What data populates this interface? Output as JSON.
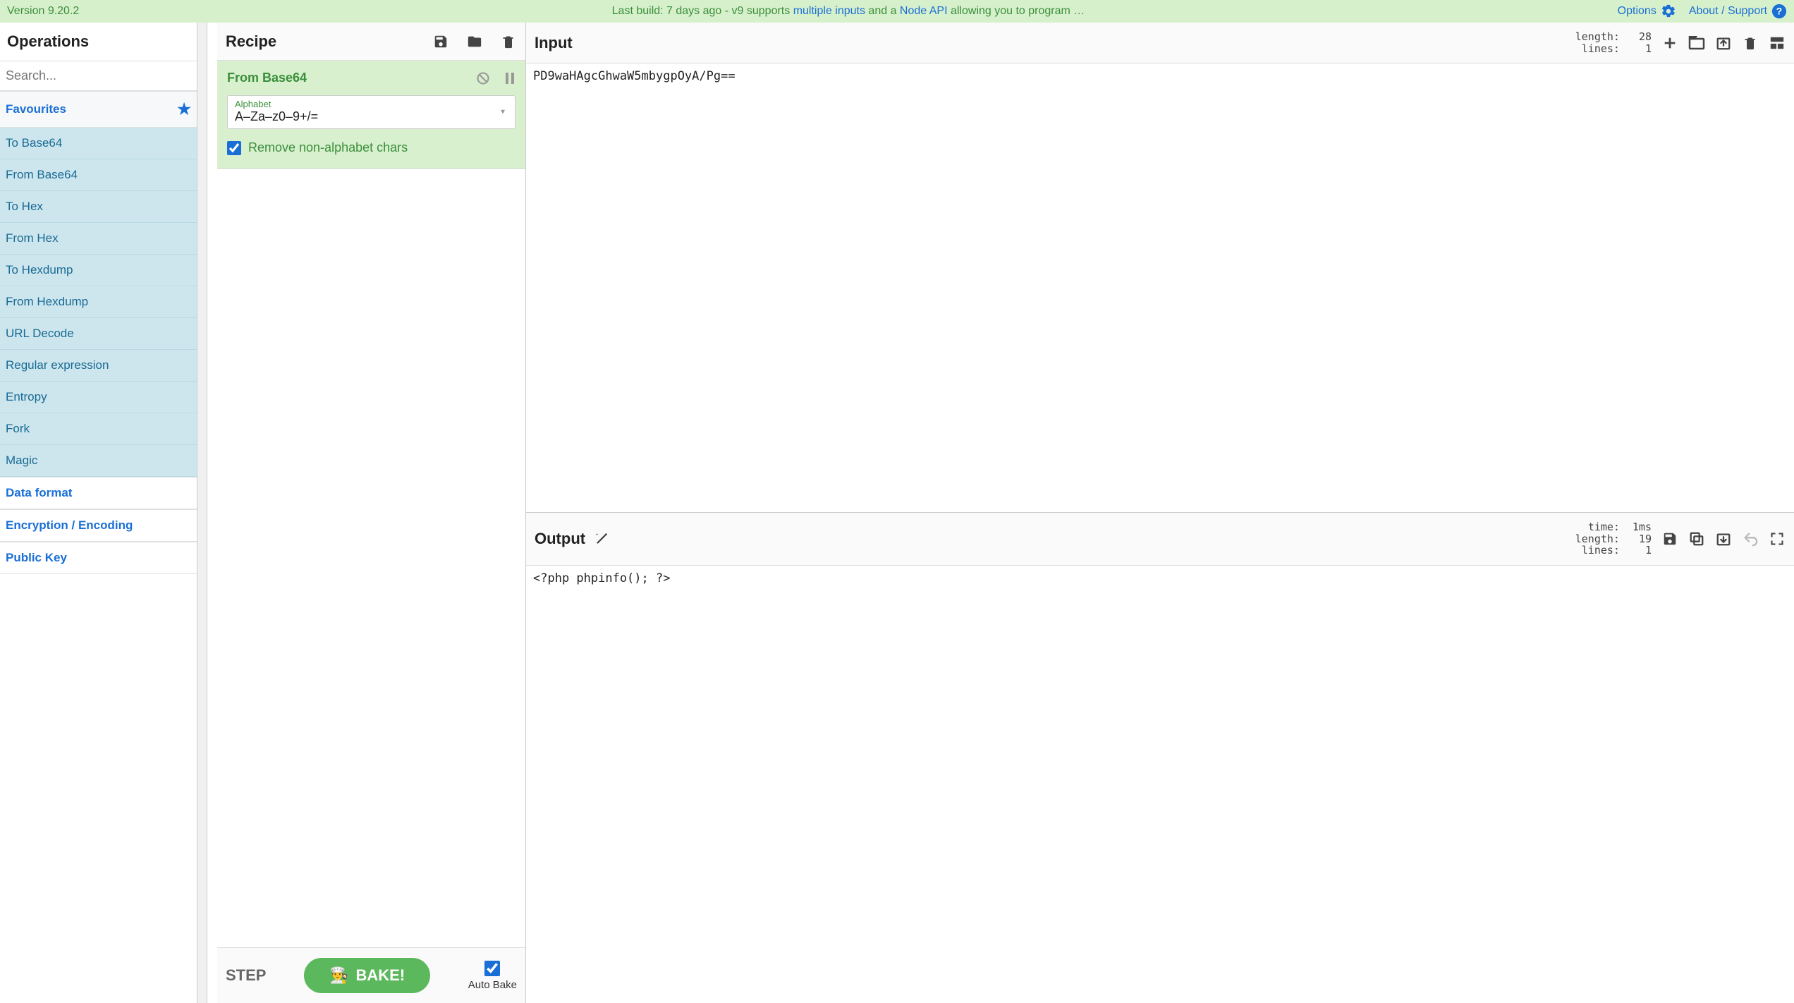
{
  "banner": {
    "version": "Version 9.20.2",
    "news_prefix": "Last build: 7 days ago - v9 supports ",
    "news_link1": "multiple inputs",
    "news_mid": " and a ",
    "news_link2": "Node API",
    "news_suffix": " allowing you to program …",
    "options": "Options",
    "about": "About / Support"
  },
  "operations": {
    "title": "Operations",
    "search_placeholder": "Search...",
    "favourites_label": "Favourites",
    "fav_items": [
      "To Base64",
      "From Base64",
      "To Hex",
      "From Hex",
      "To Hexdump",
      "From Hexdump",
      "URL Decode",
      "Regular expression",
      "Entropy",
      "Fork",
      "Magic"
    ],
    "categories": [
      "Data format",
      "Encryption / Encoding",
      "Public Key"
    ]
  },
  "recipe": {
    "title": "Recipe",
    "op": {
      "name": "From Base64",
      "alphabet_label": "Alphabet",
      "alphabet_value": "A–Za–z0–9+/=",
      "remove_label": "Remove non-alphabet chars",
      "remove_checked": true
    },
    "step": "STEP",
    "bake": "BAKE!",
    "autobake": "Auto Bake",
    "autobake_checked": true
  },
  "input": {
    "title": "Input",
    "stats": {
      "length_label": "length:",
      "length_value": "28",
      "lines_label": "lines:",
      "lines_value": "1"
    },
    "text": "PD9waHAgcGhwaW5mbygpOyA/Pg=="
  },
  "output": {
    "title": "Output",
    "stats": {
      "time_label": "time:",
      "time_value": "1ms",
      "length_label": "length:",
      "length_value": "19",
      "lines_label": "lines:",
      "lines_value": "1"
    },
    "text": "<?php phpinfo(); ?>"
  }
}
